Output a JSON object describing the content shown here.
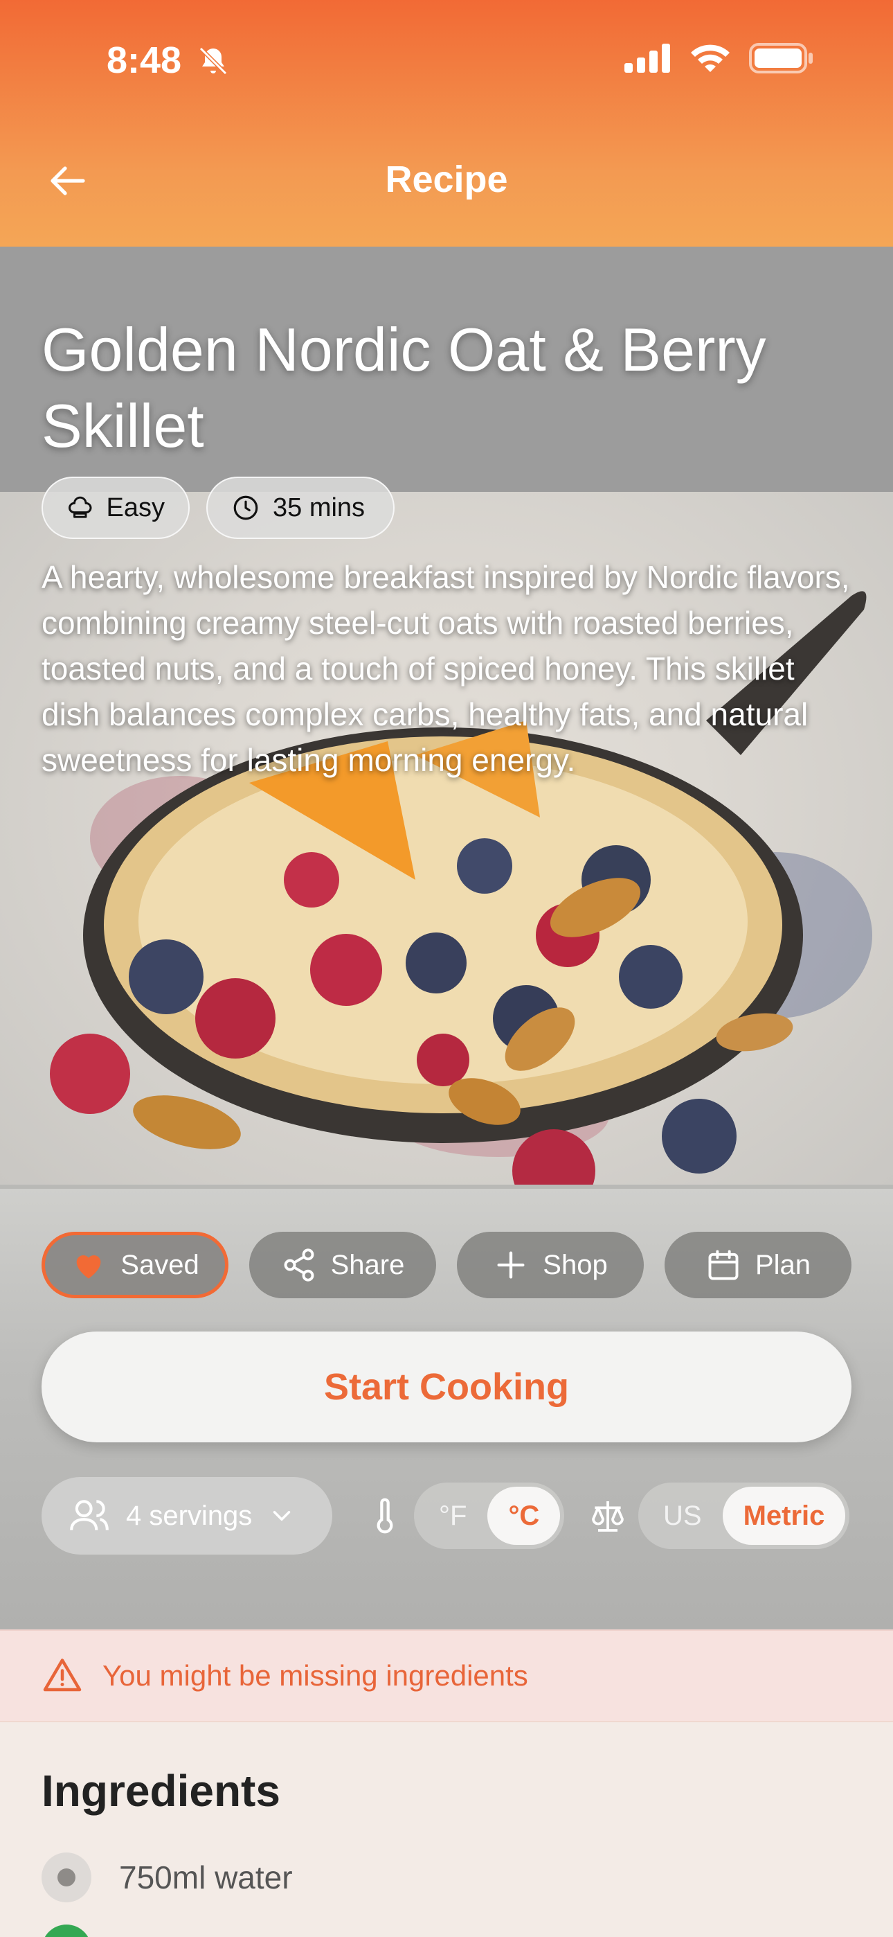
{
  "status_bar": {
    "time": "8:48"
  },
  "header": {
    "title": "Recipe"
  },
  "recipe": {
    "title": "Golden Nordic Oat & Berry Skillet",
    "difficulty": "Easy",
    "duration": "35 mins",
    "description": "A hearty, wholesome breakfast inspired by Nordic flavors, combining creamy steel-cut oats with roasted berries, toasted nuts, and a touch of spiced honey. This skillet dish balances complex carbs, healthy fats, and natural sweetness for lasting morning energy."
  },
  "actions": {
    "saved": "Saved",
    "share": "Share",
    "shop": "Shop",
    "plan": "Plan"
  },
  "start_cooking": "Start Cooking",
  "controls": {
    "servings": "4 servings",
    "temp_f": "°F",
    "temp_c": "°C",
    "unit_us": "US",
    "unit_metric": "Metric"
  },
  "banner": {
    "text": "You might be missing ingredients"
  },
  "ingredients": {
    "title": "Ingredients",
    "items": [
      "750ml water"
    ]
  },
  "colors": {
    "accent": "#EC6A38",
    "header_top": "#F26A35",
    "header_bottom": "#F4A656"
  }
}
